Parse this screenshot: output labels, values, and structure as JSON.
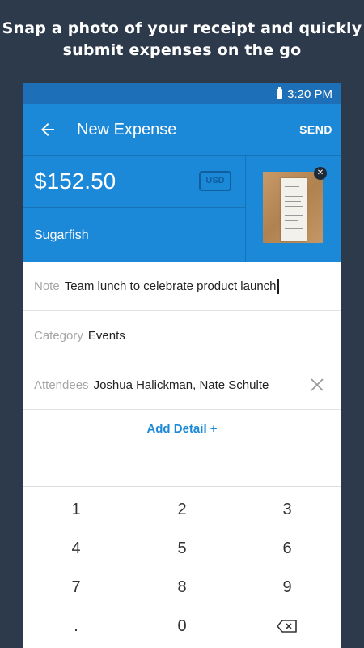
{
  "promo": {
    "line1": "Snap a photo of your receipt and quickly",
    "line2": "submit expenses on the go"
  },
  "status": {
    "time": "3:20 PM",
    "icon": "battery-icon"
  },
  "appbar": {
    "back_icon": "back-arrow-icon",
    "title": "New Expense",
    "send_label": "SEND"
  },
  "expense": {
    "amount": "$152.50",
    "currency": "USD",
    "merchant": "Sugarfish",
    "receipt_icon": "receipt-photo",
    "remove_icon": "close-icon"
  },
  "fields": {
    "note": {
      "label": "Note",
      "value": "Team lunch to celebrate product launch"
    },
    "category": {
      "label": "Category",
      "value": "Events"
    },
    "attendees": {
      "label": "Attendees",
      "value": "Joshua Halickman, Nate Schulte",
      "clear_icon": "clear-x-icon"
    }
  },
  "add_detail": "Add Detail +",
  "keypad": {
    "keys": [
      "1",
      "2",
      "3",
      "4",
      "5",
      "6",
      "7",
      "8",
      "9",
      ".",
      "0"
    ],
    "backspace_icon": "backspace-icon"
  },
  "colors": {
    "background": "#2d3a4b",
    "status_bar": "#1d70b8",
    "primary": "#1c88d8",
    "accent_dark": "#0d5f9e"
  }
}
